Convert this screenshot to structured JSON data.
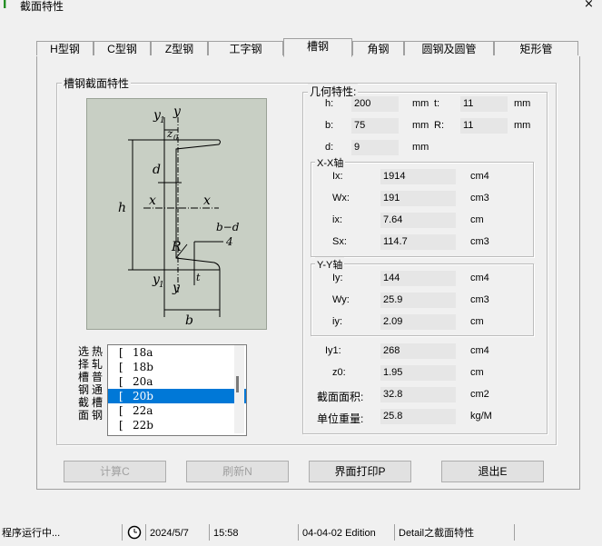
{
  "window": {
    "title": "截面特性",
    "close_glyph": "×"
  },
  "tabs": [
    {
      "label": "H型钢",
      "active": false
    },
    {
      "label": "C型钢",
      "active": false
    },
    {
      "label": "Z型钢",
      "active": false
    },
    {
      "label": "工字钢",
      "active": false
    },
    {
      "label": "槽钢",
      "active": true
    },
    {
      "label": "角钢",
      "active": false
    },
    {
      "label": "圆钢及圆管",
      "active": false
    },
    {
      "label": "矩形管",
      "active": false
    }
  ],
  "section_group": {
    "title": "槽钢截面特性"
  },
  "diagram_labels": {
    "y1_top": "y",
    "y1_sub": "1",
    "y_top": "y",
    "z0": "z",
    "z0_sub": "0",
    "d": "d",
    "h": "h",
    "x_left": "x",
    "x_right": "x",
    "bd_num": "b−d",
    "bd_den": "4",
    "R": "R",
    "y1_bot": "y",
    "y1_bot_sub": "1",
    "y_bot": "y",
    "t": "t",
    "b": "b"
  },
  "selector": {
    "label_col1": [
      "选",
      "择",
      "槽",
      "钢",
      "截",
      "面"
    ],
    "label_col2": [
      "热",
      "轧",
      "普",
      "通",
      "槽",
      "钢"
    ],
    "items": [
      {
        "bracket": "[",
        "name": "18a",
        "selected": false
      },
      {
        "bracket": "[",
        "name": "18b",
        "selected": false
      },
      {
        "bracket": "[",
        "name": "20a",
        "selected": false
      },
      {
        "bracket": "[",
        "name": "20b",
        "selected": true
      },
      {
        "bracket": "[",
        "name": "22a",
        "selected": false
      },
      {
        "bracket": "[",
        "name": "22b",
        "selected": false
      }
    ]
  },
  "geometry": {
    "title": "几何特性:",
    "h": {
      "label": "h:",
      "value": "200",
      "unit": "mm"
    },
    "t": {
      "label": "t:",
      "value": "11",
      "unit": "mm"
    },
    "b": {
      "label": "b:",
      "value": "75",
      "unit": "mm"
    },
    "R": {
      "label": "R:",
      "value": "11",
      "unit": "mm"
    },
    "d": {
      "label": "d:",
      "value": "9",
      "unit": "mm"
    }
  },
  "xx_axis": {
    "title": "X-X轴",
    "Ix": {
      "label": "Ix:",
      "value": "1914",
      "unit": "cm4"
    },
    "Wx": {
      "label": "Wx:",
      "value": "191",
      "unit": "cm3"
    },
    "ix": {
      "label": "ix:",
      "value": "7.64",
      "unit": "cm"
    },
    "Sx": {
      "label": "Sx:",
      "value": "114.7",
      "unit": "cm3"
    }
  },
  "yy_axis": {
    "title": "Y-Y轴",
    "Iy": {
      "label": "Iy:",
      "value": "144",
      "unit": "cm4"
    },
    "Wy": {
      "label": "Wy:",
      "value": "25.9",
      "unit": "cm3"
    },
    "iy": {
      "label": "iy:",
      "value": "2.09",
      "unit": "cm"
    }
  },
  "other": {
    "Iy1": {
      "label": "Iy1:",
      "value": "268",
      "unit": "cm4"
    },
    "z0": {
      "label": "z0:",
      "value": "1.95",
      "unit": "cm"
    },
    "area": {
      "label": "截面面积:",
      "value": "32.8",
      "unit": "cm2"
    },
    "weight": {
      "label": "单位重量:",
      "value": "25.8",
      "unit": "kg/M"
    }
  },
  "buttons": {
    "calc": "计算C",
    "refresh": "刷新N",
    "print": "界面打印P",
    "exit": "退出E"
  },
  "status": {
    "running": "程序运行中...",
    "date": "2024/5/7",
    "time": "15:58",
    "edition": "04-04-02 Edition",
    "module": "Detail之截面特性"
  }
}
